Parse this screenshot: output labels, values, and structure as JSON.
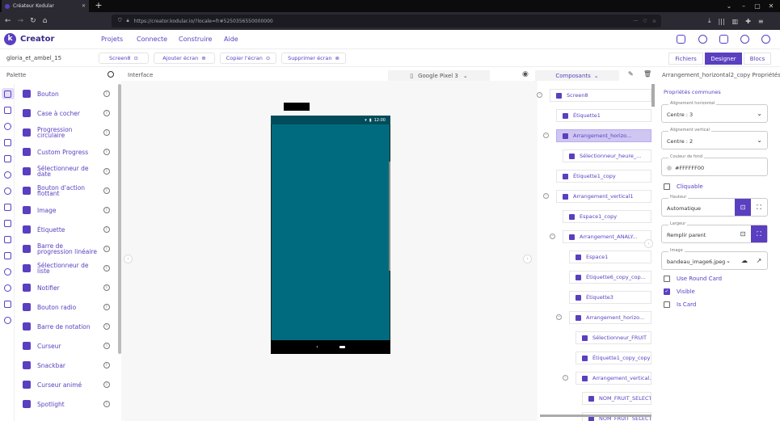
{
  "browser": {
    "tab_title": "Créateur Kodular",
    "url": "https://creator.kodular.io/?locale=fr#5250356550000000"
  },
  "app": {
    "brand": "Creator",
    "menus": [
      "Projets",
      "Connecte",
      "Construire",
      "Aide"
    ]
  },
  "toolbar": {
    "project_name": "gloria_et_ambel_15",
    "screen": "Screen8",
    "add_screen": "Ajouter écran",
    "copy_screen": "Copier l'écran",
    "delete_screen": "Supprimer écran",
    "views": [
      "Fichiers",
      "Designer",
      "Blocs"
    ],
    "active_view": "Designer"
  },
  "palette": {
    "title": "Palette",
    "items": [
      {
        "label": "Bouton",
        "icon": "button-icon"
      },
      {
        "label": "Case à cocher",
        "icon": "checkbox-icon"
      },
      {
        "label": "Progression circulaire",
        "icon": "circular-progress-icon"
      },
      {
        "label": "Custom Progress",
        "icon": "custom-progress-icon"
      },
      {
        "label": "Sélectionneur de date",
        "icon": "date-picker-icon"
      },
      {
        "label": "Bouton d'action flottant",
        "icon": "fab-icon"
      },
      {
        "label": "Image",
        "icon": "image-icon"
      },
      {
        "label": "Étiquette",
        "icon": "label-icon"
      },
      {
        "label": "Barre de progression linéaire",
        "icon": "linear-progress-icon"
      },
      {
        "label": "Sélectionneur de liste",
        "icon": "list-picker-icon"
      },
      {
        "label": "Notifier",
        "icon": "bell-icon"
      },
      {
        "label": "Bouton radio",
        "icon": "radio-icon"
      },
      {
        "label": "Barre de notation",
        "icon": "star-icon"
      },
      {
        "label": "Curseur",
        "icon": "slider-icon"
      },
      {
        "label": "Snackbar",
        "icon": "snackbar-icon"
      },
      {
        "label": "Curseur animé",
        "icon": "animated-slider-icon"
      },
      {
        "label": "Spotlight",
        "icon": "spotlight-icon"
      }
    ]
  },
  "viewer": {
    "title": "Interface",
    "device": "Google Pixel 3",
    "clock": "12:00"
  },
  "components": {
    "title": "Composants",
    "nodes": [
      {
        "label": "Screen8",
        "depth": 0,
        "toggle": "-",
        "selected": false
      },
      {
        "label": "Étiquette1",
        "depth": 1,
        "toggle": "",
        "selected": false
      },
      {
        "label": "Arrangement_horizo...",
        "depth": 1,
        "toggle": "-",
        "selected": true
      },
      {
        "label": "Sélectionneur_heure_...",
        "depth": 2,
        "toggle": "",
        "selected": false
      },
      {
        "label": "Étiquette1_copy",
        "depth": 1,
        "toggle": "",
        "selected": false
      },
      {
        "label": "Arrangement_vertical1",
        "depth": 1,
        "toggle": "-",
        "selected": false
      },
      {
        "label": "Espace1_copy",
        "depth": 2,
        "toggle": "",
        "selected": false
      },
      {
        "label": "Arrangement_ANALY...",
        "depth": 2,
        "toggle": "-",
        "selected": false
      },
      {
        "label": "Espace1",
        "depth": 3,
        "toggle": "",
        "selected": false
      },
      {
        "label": "Étiquette6_copy_cop...",
        "depth": 3,
        "toggle": "",
        "selected": false
      },
      {
        "label": "Étiquette3",
        "depth": 3,
        "toggle": "",
        "selected": false
      },
      {
        "label": "Arrangement_horizo...",
        "depth": 3,
        "toggle": "-",
        "selected": false
      },
      {
        "label": "Sélectionneur_FRUIT",
        "depth": 4,
        "toggle": "",
        "selected": false
      },
      {
        "label": "Étiquette1_copy_copy",
        "depth": 4,
        "toggle": "",
        "selected": false
      },
      {
        "label": "Arrangement_vertical...",
        "depth": 4,
        "toggle": "-",
        "selected": false
      },
      {
        "label": "NOM_FRUIT_SELECT...",
        "depth": 5,
        "toggle": "",
        "selected": false
      },
      {
        "label": "NOM_FRUIT_SELECT...",
        "depth": 5,
        "toggle": "",
        "selected": false
      }
    ]
  },
  "properties": {
    "title": "Arrangement_horizontal2_copy Propriétés",
    "section": "Propriétés communes",
    "align_h_label": "Alignement horizontal",
    "align_h_value": "Centre : 3",
    "align_v_label": "Alignement vertical",
    "align_v_value": "Centre : 2",
    "bg_label": "Couleur de fond",
    "bg_value": "#FFFFFF00",
    "clickable": "Cliquable",
    "height_label": "Hauteur",
    "height_value": "Automatique",
    "width_label": "Largeur",
    "width_value": "Remplir parent",
    "image_label": "Image",
    "image_value": "bandeau_image6.jpeg",
    "use_round_card": "Use Round Card",
    "visible": "Visible",
    "is_card": "Is Card"
  },
  "colors": {
    "accent": "#5a3fc0",
    "phone_screen": "#006b7e",
    "selection": "#cfc6f2"
  }
}
